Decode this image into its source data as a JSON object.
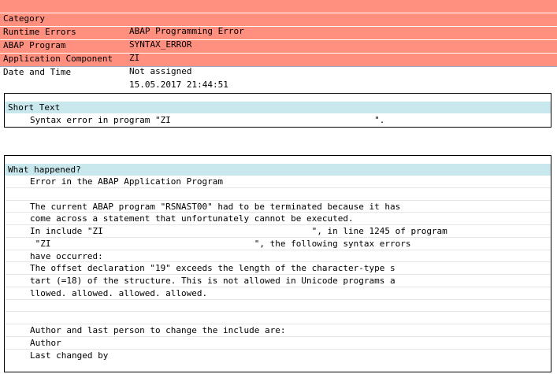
{
  "header": {
    "rows": [
      {
        "key": "Category",
        "value": "ABAP Programming Error"
      },
      {
        "key": "Runtime Errors",
        "value": "SYNTAX_ERROR"
      },
      {
        "key": "ABAP Program",
        "value": "ZI"
      },
      {
        "key": "Application Component",
        "value": "Not assigned"
      },
      {
        "key": "Date and Time",
        "value": "15.05.2017 21:44:51"
      }
    ]
  },
  "short_text": {
    "title": "Short Text",
    "lines": [
      "Syntax error in program \"ZI                                       \"."
    ]
  },
  "what_happened": {
    "title": "What happened?",
    "lines": [
      "Error in the ABAP Application Program",
      "",
      "The current ABAP program \"RSNAST00\" had to be terminated because it has",
      "come across a statement that unfortunately cannot be executed.",
      "In include \"ZI                                        \", in line 1245 of program",
      " \"ZI                                       \", the following syntax errors",
      "have occurred:",
      "The offset declaration \"19\" exceeds the length of the character-type s",
      "tart (=18) of the structure. This is not allowed in Unicode programs a",
      "llowed. allowed. allowed. allowed.",
      "",
      "",
      "Author and last person to change the include are:",
      "Author",
      "Last changed by"
    ]
  }
}
